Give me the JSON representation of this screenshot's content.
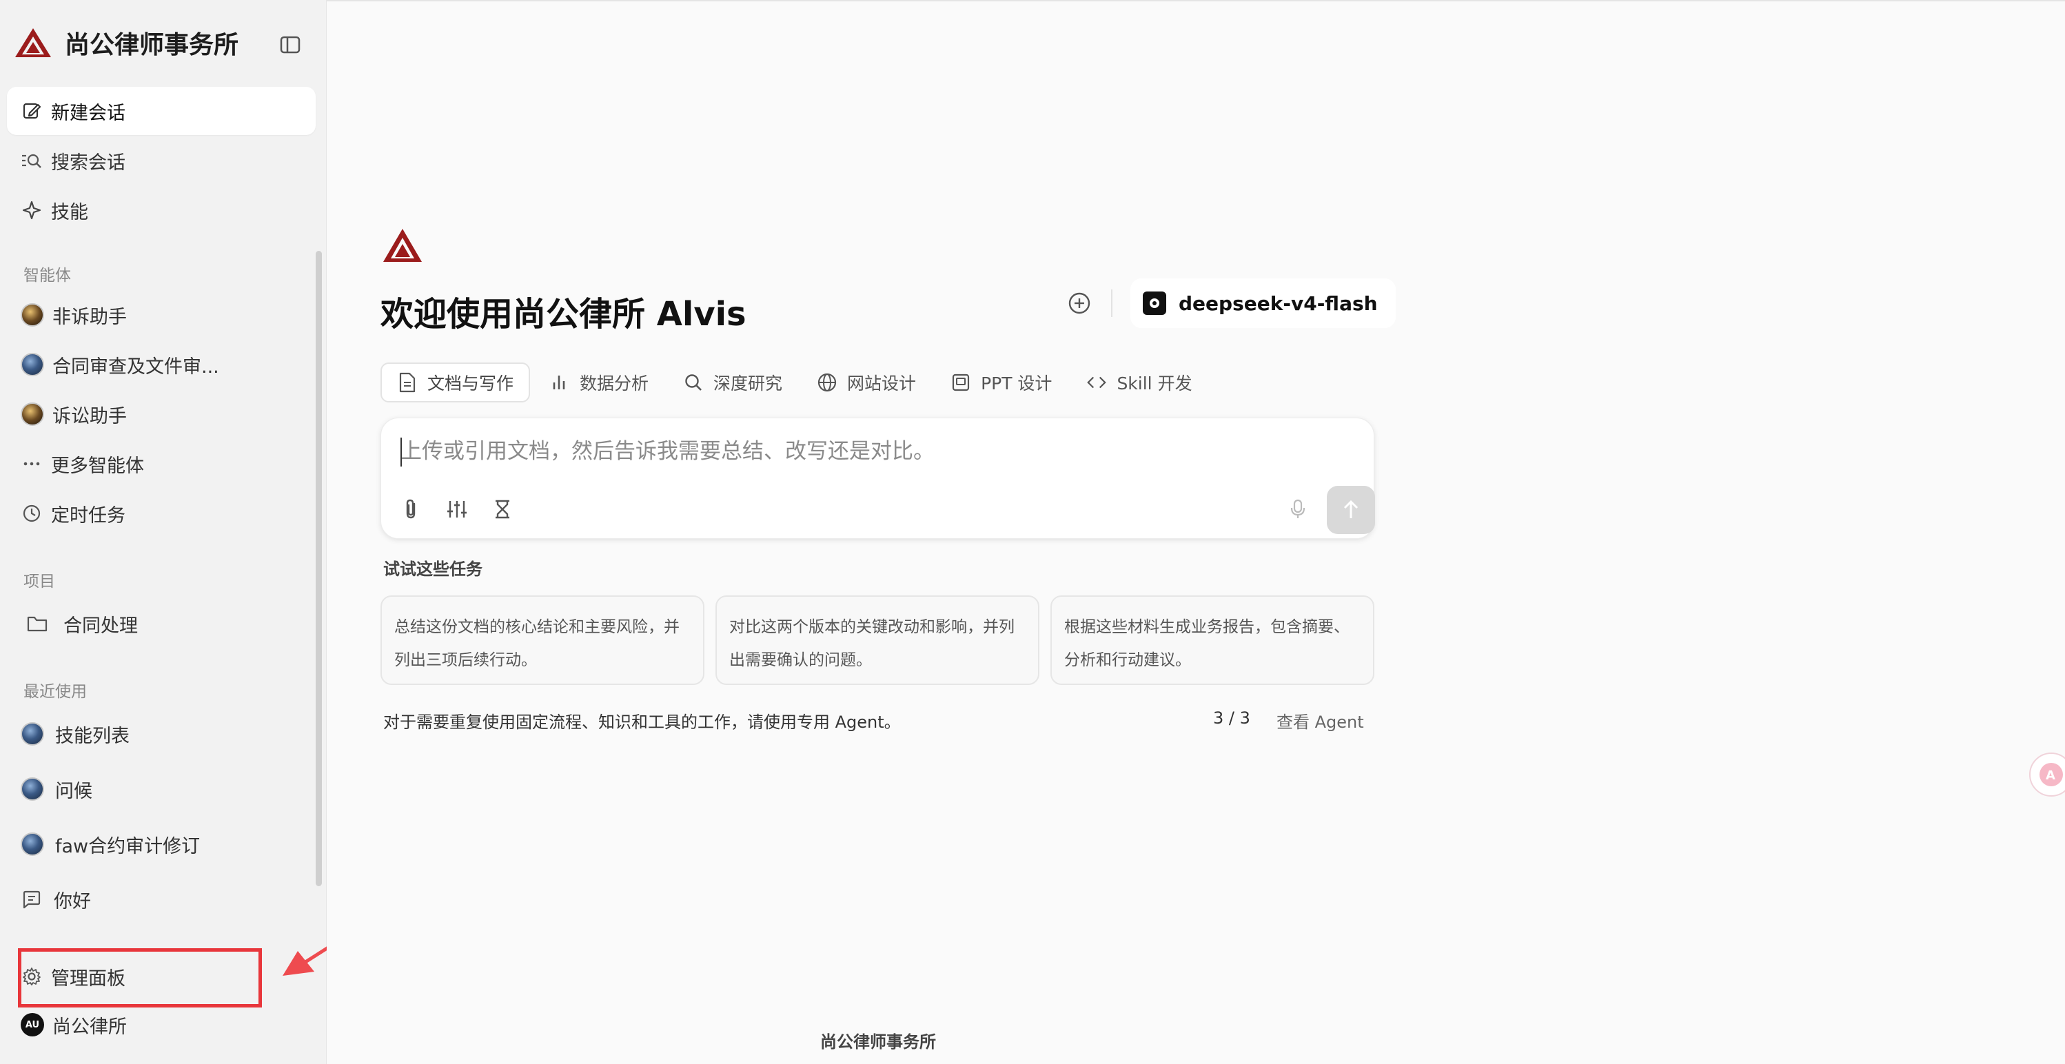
{
  "sidebar": {
    "brand_title": "尚公律师事务所",
    "nav": {
      "new_chat": "新建会话",
      "search_chat": "搜索会话",
      "skills": "技能"
    },
    "agents_label": "智能体",
    "agents": [
      {
        "label": "非诉助手"
      },
      {
        "label": "合同审查及文件审..."
      },
      {
        "label": "诉讼助手"
      }
    ],
    "more_agents": "更多智能体",
    "scheduled_tasks": "定时任务",
    "projects_label": "项目",
    "projects": [
      {
        "label": "合同处理"
      }
    ],
    "recent_label": "最近使用",
    "recent": [
      {
        "label": "技能列表"
      },
      {
        "label": "问候"
      },
      {
        "label": "faw合约审计修订"
      },
      {
        "label": "你好"
      }
    ],
    "admin_panel": "管理面板",
    "user": {
      "initials": "AU",
      "name": "尚公律所"
    }
  },
  "main": {
    "welcome": "欢迎使用尚公律所 Alvis",
    "model": "deepseek-v4-flash",
    "tabs": [
      {
        "label": "文档与写作",
        "icon": "document-icon"
      },
      {
        "label": "数据分析",
        "icon": "bar-chart-icon"
      },
      {
        "label": "深度研究",
        "icon": "search-icon"
      },
      {
        "label": "网站设计",
        "icon": "globe-icon"
      },
      {
        "label": "PPT 设计",
        "icon": "slides-icon"
      },
      {
        "label": "Skill 开发",
        "icon": "code-icon"
      }
    ],
    "composer_placeholder": "上传或引用文档，然后告诉我需要总结、改写还是对比。",
    "try_title": "试试这些任务",
    "suggestions": [
      {
        "text": "总结这份文档的核心结论和主要风险，并列出三项后续行动。"
      },
      {
        "text": "对比这两个版本的关键改动和影响，并列出需要确认的问题。"
      },
      {
        "text": "根据这些材料生成业务报告，包含摘要、分析和行动建议。"
      }
    ],
    "footer_note": "对于需要重复使用固定流程、知识和工具的工作，请使用专用 Agent。",
    "pager": "3 / 3",
    "view_agent": "查看 Agent",
    "bottom_brand": "尚公律师事务所"
  },
  "colors": {
    "brand": "#9b1c1c",
    "highlight": "#e8363b",
    "arrow": "#ee4b4f"
  }
}
